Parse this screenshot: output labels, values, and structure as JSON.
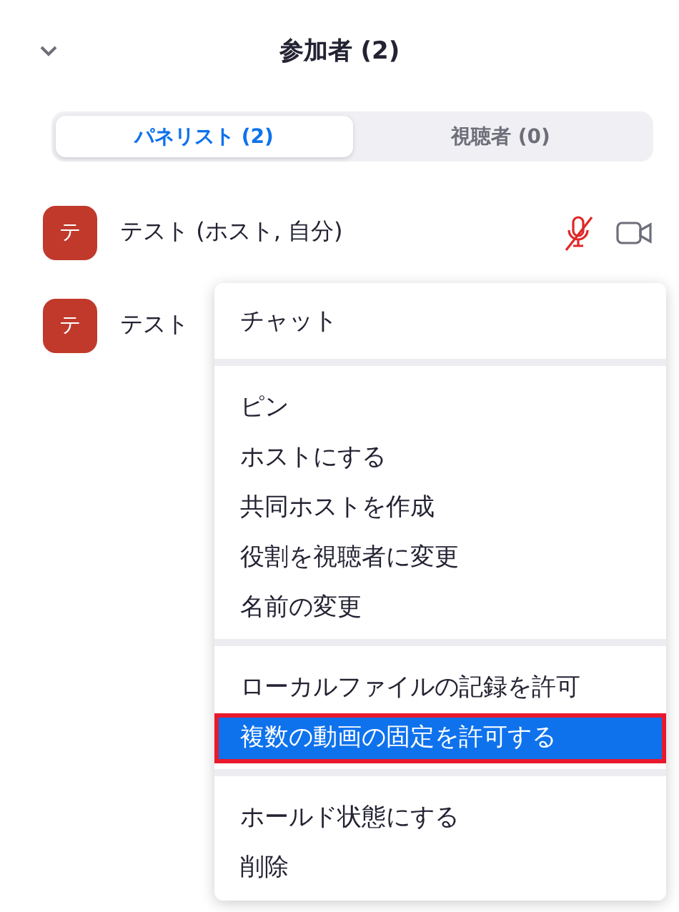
{
  "header": {
    "title": "参加者 (2)"
  },
  "tabs": [
    {
      "label": "パネリスト (2)",
      "selected": true
    },
    {
      "label": "視聴者 (0)",
      "selected": false
    }
  ],
  "participants": [
    {
      "initial": "テ",
      "name": "テスト (ホスト, 自分)",
      "muted": true
    },
    {
      "initial": "テ",
      "name": "テスト"
    }
  ],
  "menu": {
    "groups": [
      [
        {
          "label": "チャット",
          "selected": false
        }
      ],
      [
        {
          "label": "ピン",
          "selected": false
        },
        {
          "label": "ホストにする",
          "selected": false
        },
        {
          "label": "共同ホストを作成",
          "selected": false
        },
        {
          "label": "役割を視聴者に変更",
          "selected": false
        },
        {
          "label": "名前の変更",
          "selected": false
        }
      ],
      [
        {
          "label": "ローカルファイルの記録を許可",
          "selected": false
        },
        {
          "label": "複数の動画の固定を許可する",
          "selected": true
        }
      ],
      [
        {
          "label": "ホールド状態にする",
          "selected": false
        },
        {
          "label": "削除",
          "selected": false
        }
      ]
    ]
  }
}
